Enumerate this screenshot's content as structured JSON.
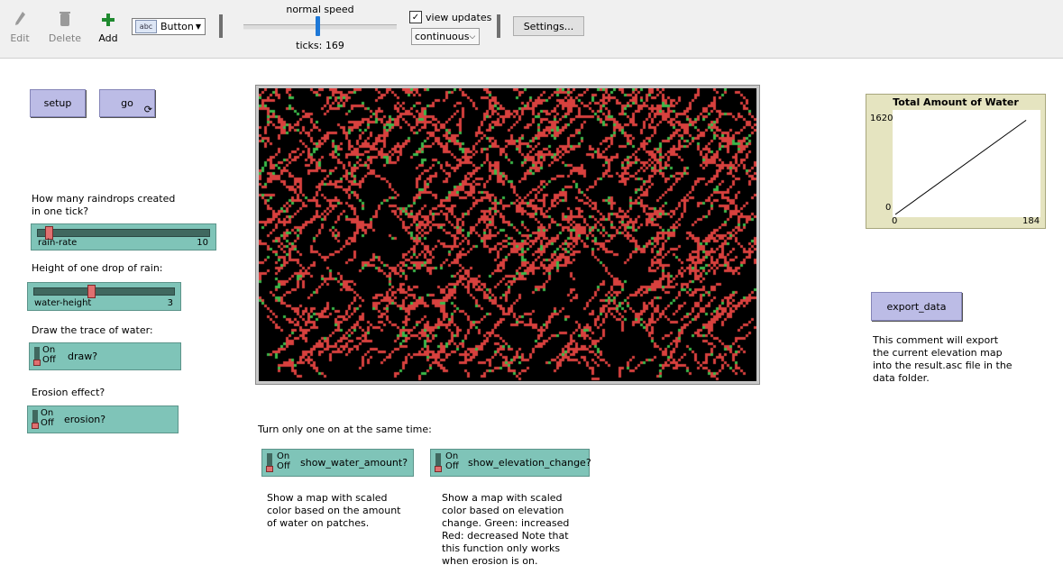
{
  "toolbar": {
    "edit_label": "Edit",
    "delete_label": "Delete",
    "add_label": "Add",
    "widget_type": "Button",
    "speed_label": "normal speed",
    "speed_level": 0.5,
    "ticks_label": "ticks: 169",
    "view_updates_label": "view updates",
    "view_updates_checked": true,
    "update_mode": "continuous",
    "settings_label": "Settings..."
  },
  "buttons": {
    "setup": "setup",
    "go": "go",
    "export": "export_data"
  },
  "controls": {
    "rain_rate": {
      "prompt": "How many raindrops created in one tick?",
      "name": "rain-rate",
      "value": "10",
      "fraction": 0.05
    },
    "water_height": {
      "prompt": "Height of one drop of rain:",
      "name": "water-height",
      "value": "3",
      "fraction": 0.4
    },
    "draw": {
      "prompt": "Draw the trace of water:",
      "name": "draw?",
      "on": "On",
      "off": "Off",
      "state": "off"
    },
    "erosion": {
      "prompt": "Erosion effect?",
      "name": "erosion?",
      "on": "On",
      "off": "Off",
      "state": "off"
    },
    "show_water": {
      "name": "show_water_amount?",
      "on": "On",
      "off": "Off",
      "state": "off"
    },
    "show_elev": {
      "name": "show_elevation_change?",
      "on": "On",
      "off": "Off",
      "state": "off"
    }
  },
  "notes": {
    "toggle_hint": "Turn only one on at the same time:",
    "water_note": "Show a map with scaled color based on the amount of water on patches.",
    "elev_note": "Show a map with scaled color based on elevation change. Green: increased Red: decreased Note that this function only works when erosion is on.",
    "export_note": "This comment will export the current elevation map into the result.asc file in the data folder."
  },
  "colors": {
    "button": "#bcbce6",
    "slider": "#7fc4b8",
    "world_bg": "#000000",
    "trace_red": "#d8413e",
    "trace_green": "#3cb94a",
    "plot_bg": "#e5e4c0"
  },
  "chart_data": {
    "type": "line",
    "title": "Total Amount of Water",
    "xlabel": "",
    "ylabel": "",
    "xlim": [
      0,
      184
    ],
    "ylim": [
      0,
      1620
    ],
    "x_ticks": [
      "0",
      "184"
    ],
    "y_ticks": [
      "0",
      "1620"
    ],
    "series": [
      {
        "x": [
          0,
          169
        ],
        "y": [
          0,
          1500
        ]
      }
    ]
  }
}
